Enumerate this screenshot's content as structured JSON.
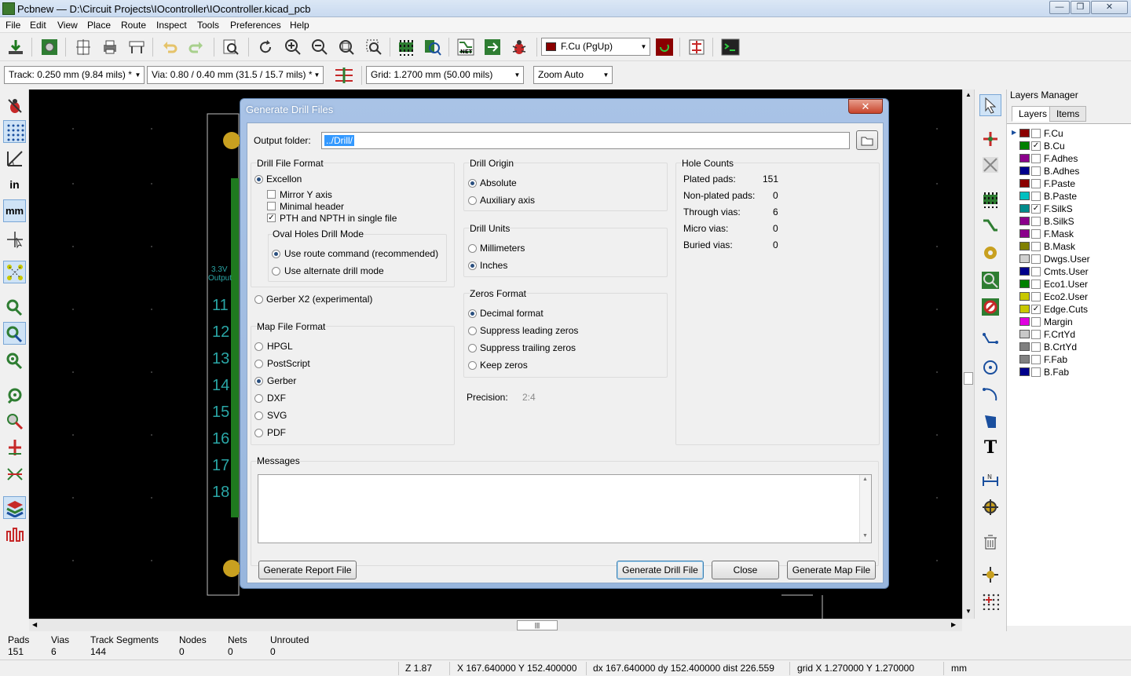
{
  "window": {
    "title": "Pcbnew — D:\\Circuit Projects\\IOcontroller\\IOcontroller.kicad_pcb"
  },
  "menu": [
    "File",
    "Edit",
    "View",
    "Place",
    "Route",
    "Inspect",
    "Tools",
    "Preferences",
    "Help"
  ],
  "toolbar": {
    "layer_select": "F.Cu (PgUp)",
    "track": "Track: 0.250 mm (9.84 mils) *",
    "via": "Via: 0.80 / 0.40 mm (31.5 / 15.7 mils) *",
    "grid": "Grid: 1.2700 mm (50.00 mils)",
    "zoom": "Zoom Auto"
  },
  "left_toolbar": {
    "in_label": "in",
    "mm_label": "mm"
  },
  "canvas": {
    "pcb_label_1": "3.3V",
    "pcb_label_2": "Output",
    "pin_numbers": [
      "11",
      "12",
      "13",
      "14",
      "15",
      "16",
      "17",
      "18"
    ]
  },
  "layers_manager": {
    "title": "Layers Manager",
    "tabs": [
      "Layers",
      "Items"
    ],
    "layers": [
      {
        "name": "F.Cu",
        "color": "#8b0000",
        "checked": false
      },
      {
        "name": "B.Cu",
        "color": "#008000",
        "checked": true
      },
      {
        "name": "F.Adhes",
        "color": "#8b008b",
        "checked": false
      },
      {
        "name": "B.Adhes",
        "color": "#00008b",
        "checked": false
      },
      {
        "name": "F.Paste",
        "color": "#8b0000",
        "checked": false
      },
      {
        "name": "B.Paste",
        "color": "#00c0c0",
        "checked": false
      },
      {
        "name": "F.SilkS",
        "color": "#008b8b",
        "checked": true
      },
      {
        "name": "B.SilkS",
        "color": "#8b008b",
        "checked": false
      },
      {
        "name": "F.Mask",
        "color": "#8b008b",
        "checked": false
      },
      {
        "name": "B.Mask",
        "color": "#808000",
        "checked": false
      },
      {
        "name": "Dwgs.User",
        "color": "#d0d0d0",
        "checked": false
      },
      {
        "name": "Cmts.User",
        "color": "#00008b",
        "checked": false
      },
      {
        "name": "Eco1.User",
        "color": "#008000",
        "checked": false
      },
      {
        "name": "Eco2.User",
        "color": "#c8c800",
        "checked": false
      },
      {
        "name": "Edge.Cuts",
        "color": "#c8c800",
        "checked": true
      },
      {
        "name": "Margin",
        "color": "#e000e0",
        "checked": false
      },
      {
        "name": "F.CrtYd",
        "color": "#c8c8c8",
        "checked": false
      },
      {
        "name": "B.CrtYd",
        "color": "#808080",
        "checked": false
      },
      {
        "name": "F.Fab",
        "color": "#808080",
        "checked": false
      },
      {
        "name": "B.Fab",
        "color": "#00008b",
        "checked": false
      }
    ]
  },
  "status": {
    "headers": [
      "Pads",
      "Vias",
      "Track Segments",
      "Nodes",
      "Nets",
      "Unrouted"
    ],
    "values": [
      "151",
      "6",
      "144",
      "0",
      "0",
      "0"
    ]
  },
  "coords": {
    "zoom": "Z 1.87",
    "xy": "X 167.640000  Y 152.400000",
    "delta": "dx 167.640000  dy 152.400000  dist 226.559",
    "grid": "grid X 1.270000  Y 1.270000",
    "units": "mm"
  },
  "dialog": {
    "title": "Generate Drill Files",
    "close_glyph": "✕",
    "output_folder_label": "Output folder:",
    "output_folder_value": "../Drill/",
    "drill_format": {
      "title": "Drill File Format",
      "excellon": "Excellon",
      "mirror_y": "Mirror Y axis",
      "minimal_header": "Minimal header",
      "pth_npth": "PTH and NPTH in single file",
      "oval_title": "Oval Holes Drill Mode",
      "use_route": "Use route command (recommended)",
      "use_alt": "Use alternate drill mode",
      "gerber_x2": "Gerber X2 (experimental)"
    },
    "map_format": {
      "title": "Map File Format",
      "options": [
        "HPGL",
        "PostScript",
        "Gerber",
        "DXF",
        "SVG",
        "PDF"
      ],
      "selected": "Gerber"
    },
    "drill_origin": {
      "title": "Drill Origin",
      "absolute": "Absolute",
      "auxiliary": "Auxiliary axis"
    },
    "drill_units": {
      "title": "Drill Units",
      "millimeters": "Millimeters",
      "inches": "Inches"
    },
    "zeros_format": {
      "title": "Zeros Format",
      "options": [
        "Decimal format",
        "Suppress leading zeros",
        "Suppress trailing zeros",
        "Keep zeros"
      ]
    },
    "precision_label": "Precision:",
    "precision_value": "2:4",
    "hole_counts": {
      "title": "Hole Counts",
      "rows": [
        {
          "label": "Plated pads:",
          "value": "151"
        },
        {
          "label": "Non-plated pads:",
          "value": "0"
        },
        {
          "label": "Through vias:",
          "value": "6"
        },
        {
          "label": "Micro vias:",
          "value": "0"
        },
        {
          "label": "Buried vias:",
          "value": "0"
        }
      ]
    },
    "messages_label": "Messages",
    "buttons": {
      "report": "Generate Report File",
      "drill": "Generate Drill File",
      "close": "Close",
      "map": "Generate Map File"
    }
  }
}
